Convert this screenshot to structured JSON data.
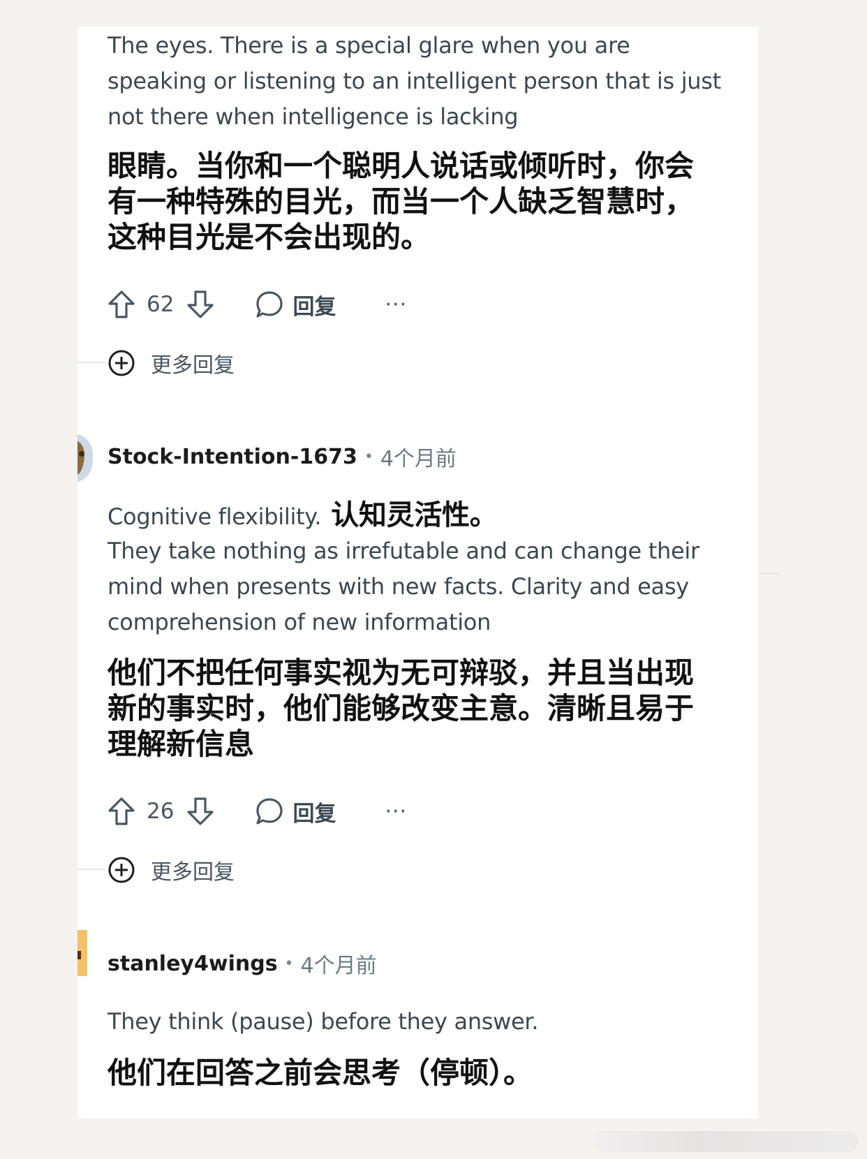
{
  "comments": [
    {
      "body_en": "The eyes. There is a special glare when you are speaking or listening to an intelligent person that is just not there when intelligence is lacking",
      "body_zh": "眼睛。当你和一个聪明人说话或倾听时，你会有一种特殊的目光，而当一个人缺乏智慧时，这种目光是不会出现的。",
      "votes": "62",
      "reply_label": "回复",
      "more_label": "···",
      "more_replies_label": "更多回复"
    },
    {
      "username": "Stock-Intention-1673",
      "separator": "•",
      "time": "4个月前",
      "body_en_lead": "Cognitive flexibility.",
      "body_zh_lead": "认知灵活性。",
      "body_en": "They take nothing as irrefutable and can change their mind when presents with new facts. Clarity and easy comprehension of new information",
      "body_zh": "他们不把任何事实视为无可辩驳，并且当出现新的事实时，他们能够改变主意。清晰且易于理解新信息",
      "votes": "26",
      "reply_label": "回复",
      "more_label": "···",
      "more_replies_label": "更多回复"
    },
    {
      "username": "stanley4wings",
      "separator": "•",
      "time": "4个月前",
      "body_en": "They think (pause) before they answer.",
      "body_zh": "他们在回答之前会思考（停顿）。"
    }
  ],
  "icons": {
    "upvote": "arrow-up-icon",
    "downvote": "arrow-down-icon",
    "reply": "speech-bubble-icon",
    "more_replies": "plus-circle-icon"
  }
}
